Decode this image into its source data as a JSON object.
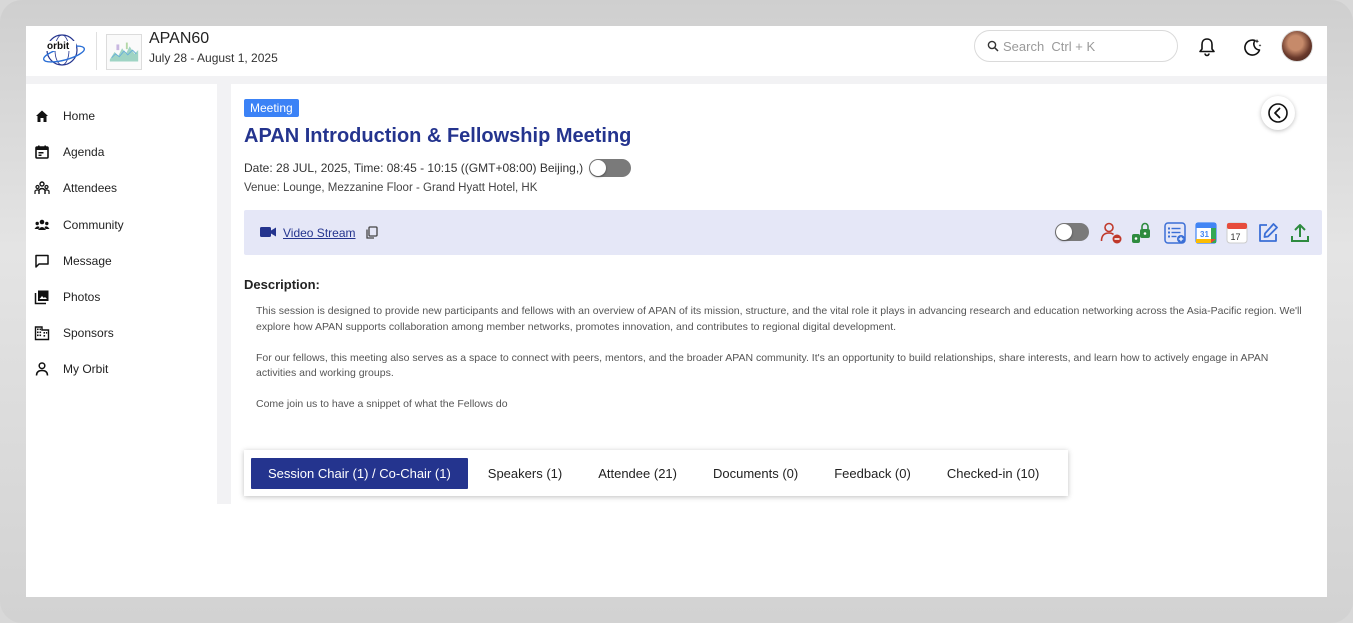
{
  "header": {
    "logo_text": "orbit",
    "event_name": "APAN60",
    "event_dates": "July 28 - August 1, 2025",
    "search_placeholder": "Search  Ctrl + K"
  },
  "sidebar": {
    "items": [
      {
        "label": "Home",
        "icon": "home-icon"
      },
      {
        "label": "Agenda",
        "icon": "calendar-icon"
      },
      {
        "label": "Attendees",
        "icon": "attendees-icon"
      },
      {
        "label": "Community",
        "icon": "community-icon"
      },
      {
        "label": "Message",
        "icon": "message-icon"
      },
      {
        "label": "Photos",
        "icon": "photos-icon"
      },
      {
        "label": "Sponsors",
        "icon": "building-icon"
      },
      {
        "label": "My Orbit",
        "icon": "person-icon"
      }
    ]
  },
  "session": {
    "type_badge": "Meeting",
    "title": "APAN Introduction & Fellowship Meeting",
    "date_line": "Date: 28 JUL, 2025, Time: 08:45 - 10:15  ((GMT+08:00) Beijing,)",
    "venue": "Venue: Lounge, Mezzanine Floor - Grand Hyatt Hotel, HK",
    "stream_label": "Video Stream",
    "description_label": "Description:",
    "description": [
      "This session is designed to provide new participants and fellows with an overview of APAN of its mission, structure, and the vital role it plays in advancing research and education networking across the Asia-Pacific region. We'll explore how APAN supports collaboration among member networks, promotes innovation, and contributes to regional digital development.",
      "For our fellows, this meeting also serves as a space to connect with peers, mentors, and the broader APAN community. It's an opportunity to build relationships, share interests, and learn how to actively engage in APAN activities and working groups.",
      "Come join us to have a snippet of what the Fellows do"
    ]
  },
  "tabs": [
    {
      "label": "Session Chair (1) / Co-Chair (1)",
      "active": true
    },
    {
      "label": "Speakers (1)",
      "active": false
    },
    {
      "label": "Attendee (21)",
      "active": false
    },
    {
      "label": "Documents (0)",
      "active": false
    },
    {
      "label": "Feedback (0)",
      "active": false
    },
    {
      "label": "Checked-in (10)",
      "active": false
    }
  ],
  "colors": {
    "brand": "#24348e",
    "badge": "#3b82f6",
    "stream_bar": "#e5e7f7"
  }
}
